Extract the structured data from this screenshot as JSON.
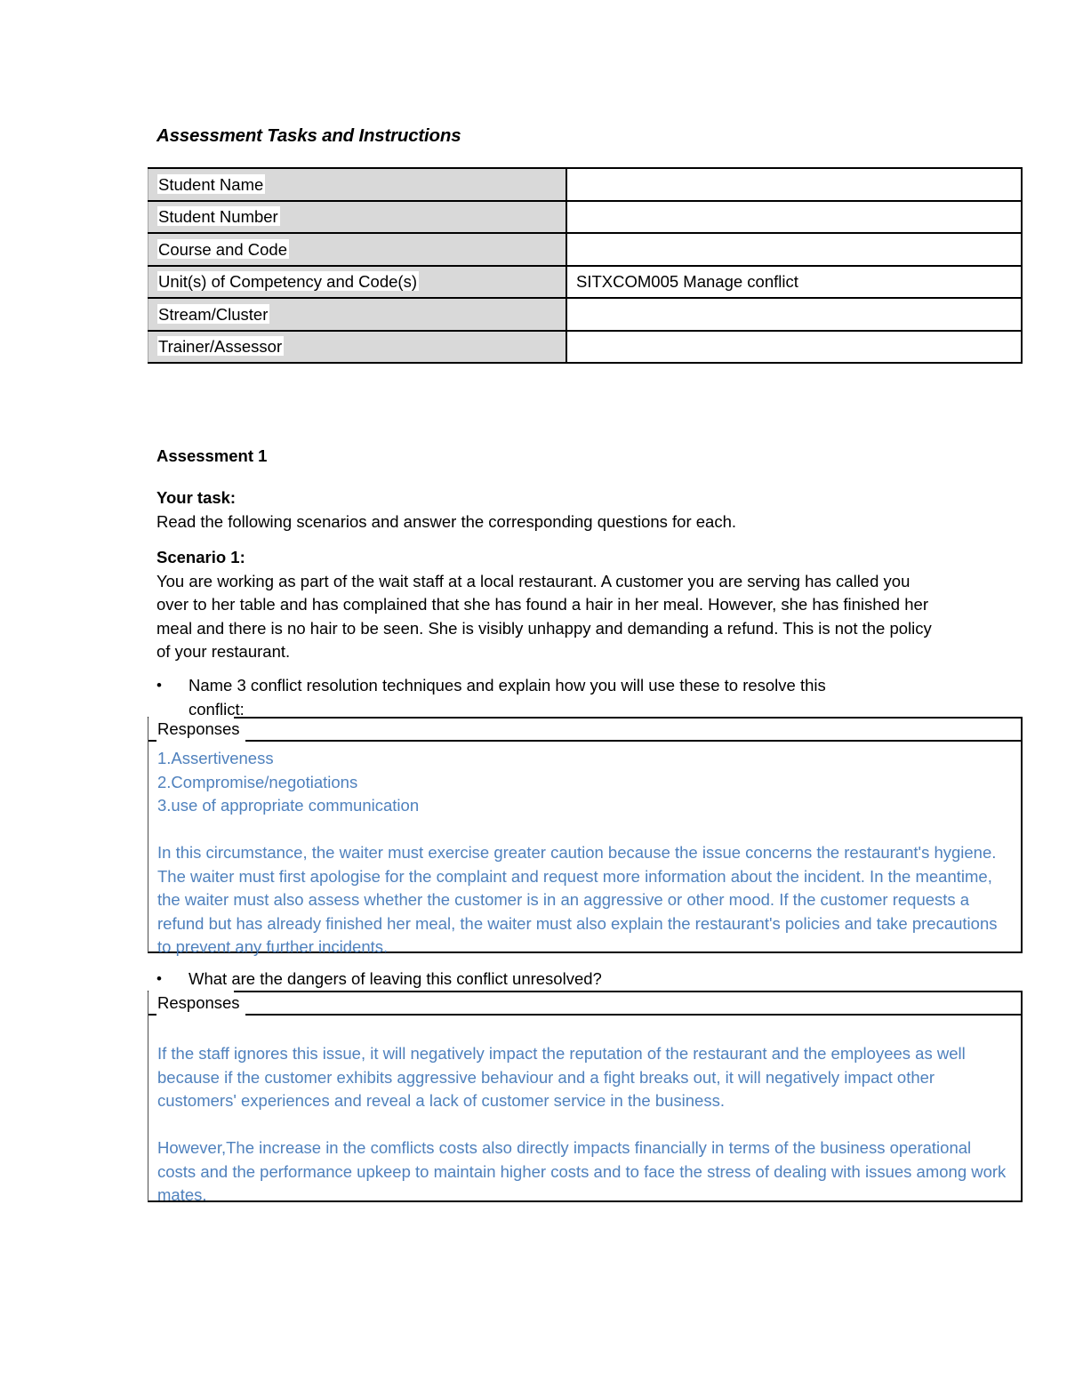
{
  "document": {
    "title": "Assessment Tasks and Instructions",
    "accent_color": "#4f81bd",
    "label_cell_color": "#d9d9d9"
  },
  "info_table": {
    "rows": [
      {
        "label": "Student Name",
        "value": ""
      },
      {
        "label": "Student Number",
        "value": ""
      },
      {
        "label": "Course and Code",
        "value": ""
      },
      {
        "label": "Unit(s) of Competency and Code(s)",
        "value": "SITXCOM005 Manage conflict"
      },
      {
        "label": "Stream/Cluster",
        "value": ""
      },
      {
        "label": "Trainer/Assessor",
        "value": ""
      }
    ]
  },
  "assessment": {
    "heading": "Assessment 1",
    "task_label": "Your task:",
    "task_text": "Read the following scenarios and answer the corresponding questions for each.",
    "scenario_label": "Scenario 1:",
    "scenario_text": "You are working as part of the wait staff at a local restaurant. A customer you are serving has called you over to her table and has complained that she has found a hair in her meal. However, she has finished her meal and there is no hair to be seen. She is visibly unhappy and demanding a refund. This is not the policy of your restaurant."
  },
  "questions": [
    {
      "bullet": "•",
      "text": "Name 3 conflict resolution techniques and explain how you will use these to resolve this conflict:",
      "responses_header": "Responses",
      "answer_lines": [
        "1.Assertiveness",
        "2.Compromise/negotiations",
        "3.use of appropriate communication"
      ],
      "answer_paragraph": "In this circumstance, the waiter must exercise greater caution because the issue concerns the restaurant's hygiene. The waiter must first apologise for the complaint and request more information about the incident. In the meantime, the waiter must also assess whether the customer is in an aggressive or other mood. If the customer requests a refund but has already finished her meal, the waiter must also explain the restaurant's policies and take precautions to prevent any further incidents."
    },
    {
      "bullet": "•",
      "text": "What are the dangers of leaving this conflict unresolved?",
      "responses_header": "Responses",
      "answer_paragraph_1": "If the staff ignores this issue, it will negatively impact the reputation of the restaurant and the employees as well because if the customer exhibits aggressive behaviour and a fight breaks out, it will negatively impact other customers' experiences and reveal a lack of customer service in the business.",
      "answer_paragraph_2": "However,The increase in the comflicts costs also directly impacts financially in terms of the business operational costs and the performance upkeep to maintain higher costs and to face the stress of dealing with issues among work mates."
    }
  ]
}
